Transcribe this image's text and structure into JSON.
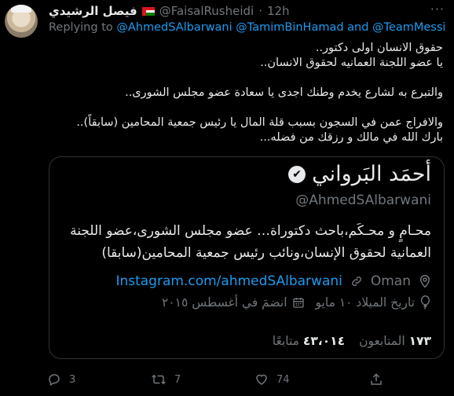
{
  "tweet": {
    "author_name": "فيصل الرشيدي",
    "author_handle": "@FaisalRusheidi",
    "separator": "·",
    "time": "12h",
    "more_label": "···",
    "replying_prefix": "Replying to",
    "replying_mentions": "@AhmedSAlbarwani @TamimBinHamad and @TeamMessi",
    "lines": [
      "حقوق الانسان اولى دكتور..",
      "يا عضو اللجنة العمانيه لحقوق الانسان..",
      "",
      "والتبرع به لشارع يخدم وطنك اجدى يا سعادة عضو مجلس الشورى..",
      "",
      "والافراج عمن في السجون بسبب قلة المال يا رئيس جمعية المحامين (سابقاً)..",
      "بارك الله في مالك و رزقك من فضله..."
    ]
  },
  "card": {
    "name": "أحمَد البَرواني",
    "verified_mark": "✔",
    "handle": "@AhmedSAlbarwani",
    "bio_lines": [
      "محـامٍ و محـكَم،باحث دكتوراة… عضو مجلس الشورى،عضو اللجنة",
      "العمانية لحقوق الإنسان،ونائب رئيس جمعية المحامين(سابقا)"
    ],
    "location": "Oman",
    "website": "Instagram.com/ahmedSAlbarwani",
    "birth": "تاريخ الميلاد ١٠ مايو",
    "joined": "انضمَ في أغسطس ٢٠١٥",
    "following_count": "١٧٣",
    "following_label": "المتابعون",
    "followers_count": "٤٣،٠١٤",
    "followers_label": "متابعًا"
  },
  "actions": {
    "reply_count": "3",
    "retweet_count": "7",
    "like_count": "74"
  },
  "colors": {
    "link": "#1d9bf0",
    "muted": "#71767b",
    "text": "#e7e9ea",
    "border": "#2f3336"
  }
}
